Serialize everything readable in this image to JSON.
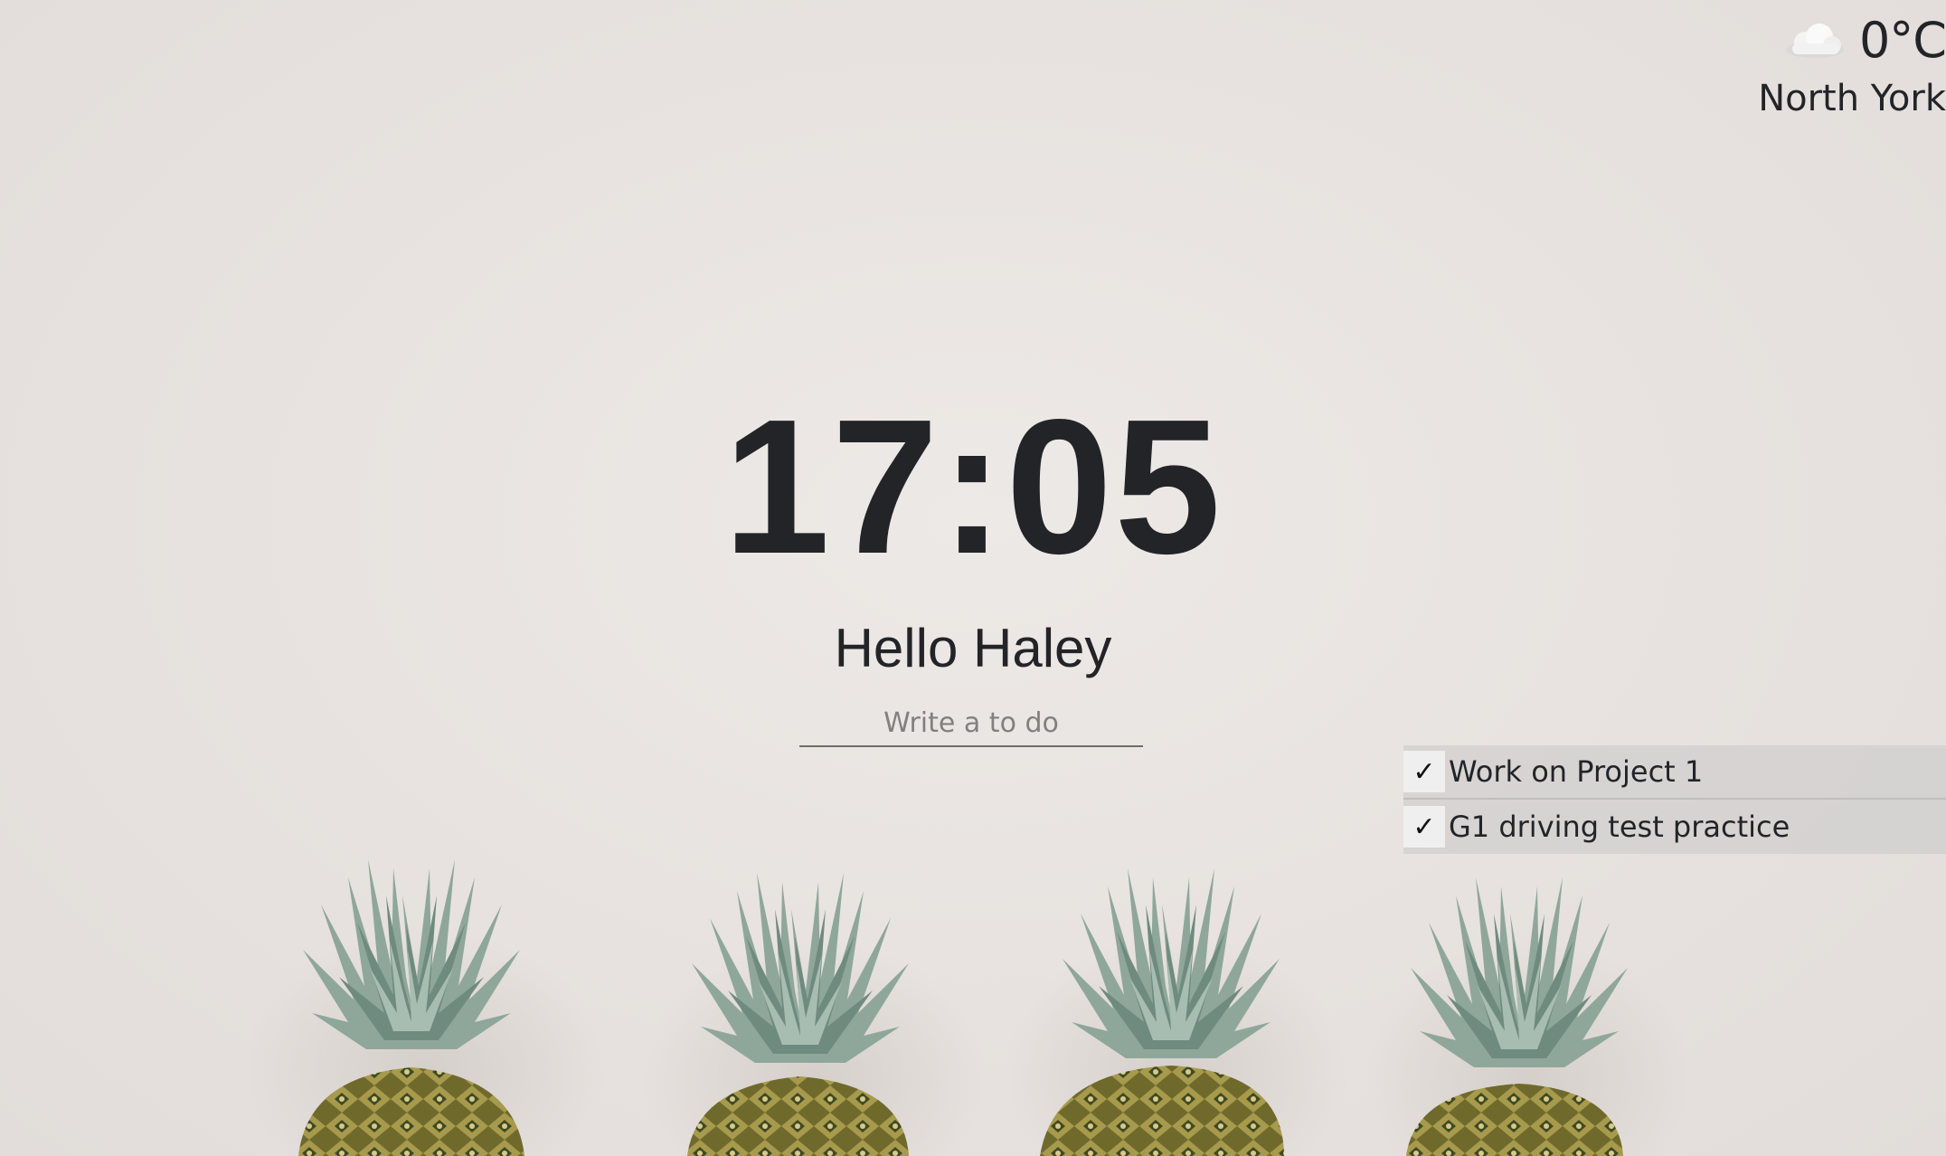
{
  "weather": {
    "icon": "cloud-icon",
    "temperature": "0°C",
    "city": "North York"
  },
  "clock": {
    "time": "17:05"
  },
  "greeting": {
    "text": "Hello Haley"
  },
  "todo_form": {
    "placeholder": "Write a to do",
    "value": ""
  },
  "todos": [
    {
      "check": "✓",
      "text": "Work on Project 1"
    },
    {
      "check": "✓",
      "text": "G1 driving test practice"
    }
  ],
  "background": {
    "description_icon": "pineapple-image",
    "colors": {
      "wall": "#e7e2df",
      "leaf": "#8fa79a",
      "fruit": "#7d7a38"
    }
  }
}
